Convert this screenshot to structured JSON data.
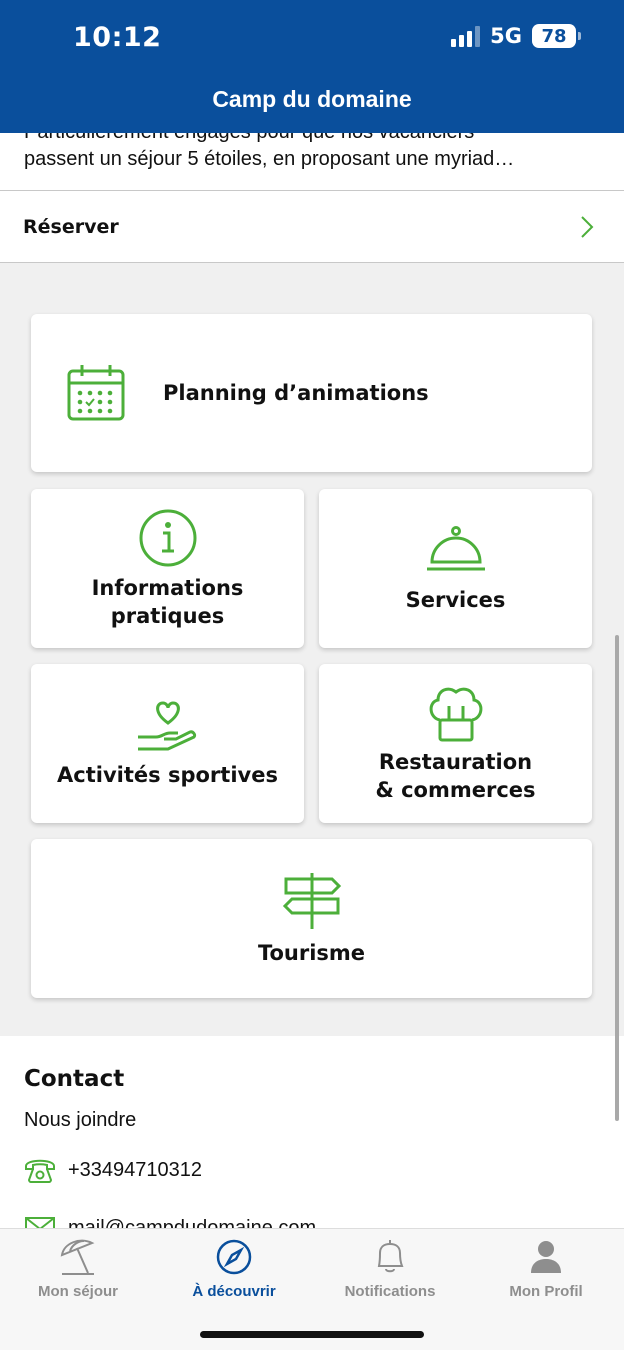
{
  "status_bar": {
    "time": "10:12",
    "network": "5G",
    "battery": "78"
  },
  "header": {
    "title": "Camp du domaine"
  },
  "intro": {
    "line1": "Particulièrement engagés pour que nos vacanciers",
    "line2": "passent un séjour 5 étoiles, en proposant une myriad…"
  },
  "reserve": {
    "label": "Réserver"
  },
  "cards": {
    "planning": "Planning d’animations",
    "informations_1": "Informations",
    "informations_2": "pratiques",
    "services": "Services",
    "activites": "Activités sportives",
    "restauration_1": "Restauration",
    "restauration_2": "& commerces",
    "tourisme": "Tourisme"
  },
  "contact": {
    "title": "Contact",
    "subtitle": "Nous joindre",
    "phone": "+33494710312",
    "email": "mail@campdudomaine.com"
  },
  "tabbar": {
    "tabs": [
      {
        "label": "Mon séjour",
        "icon": "beach-umbrella-icon",
        "active": false
      },
      {
        "label": "À découvrir",
        "icon": "compass-icon",
        "active": true
      },
      {
        "label": "Notifications",
        "icon": "bell-icon",
        "active": false
      },
      {
        "label": "Mon Profil",
        "icon": "user-icon",
        "active": false
      }
    ]
  },
  "colors": {
    "brand_blue": "#0a4f9c",
    "accent_green": "#4caf3a",
    "tab_inactive": "#8e8e8e"
  }
}
